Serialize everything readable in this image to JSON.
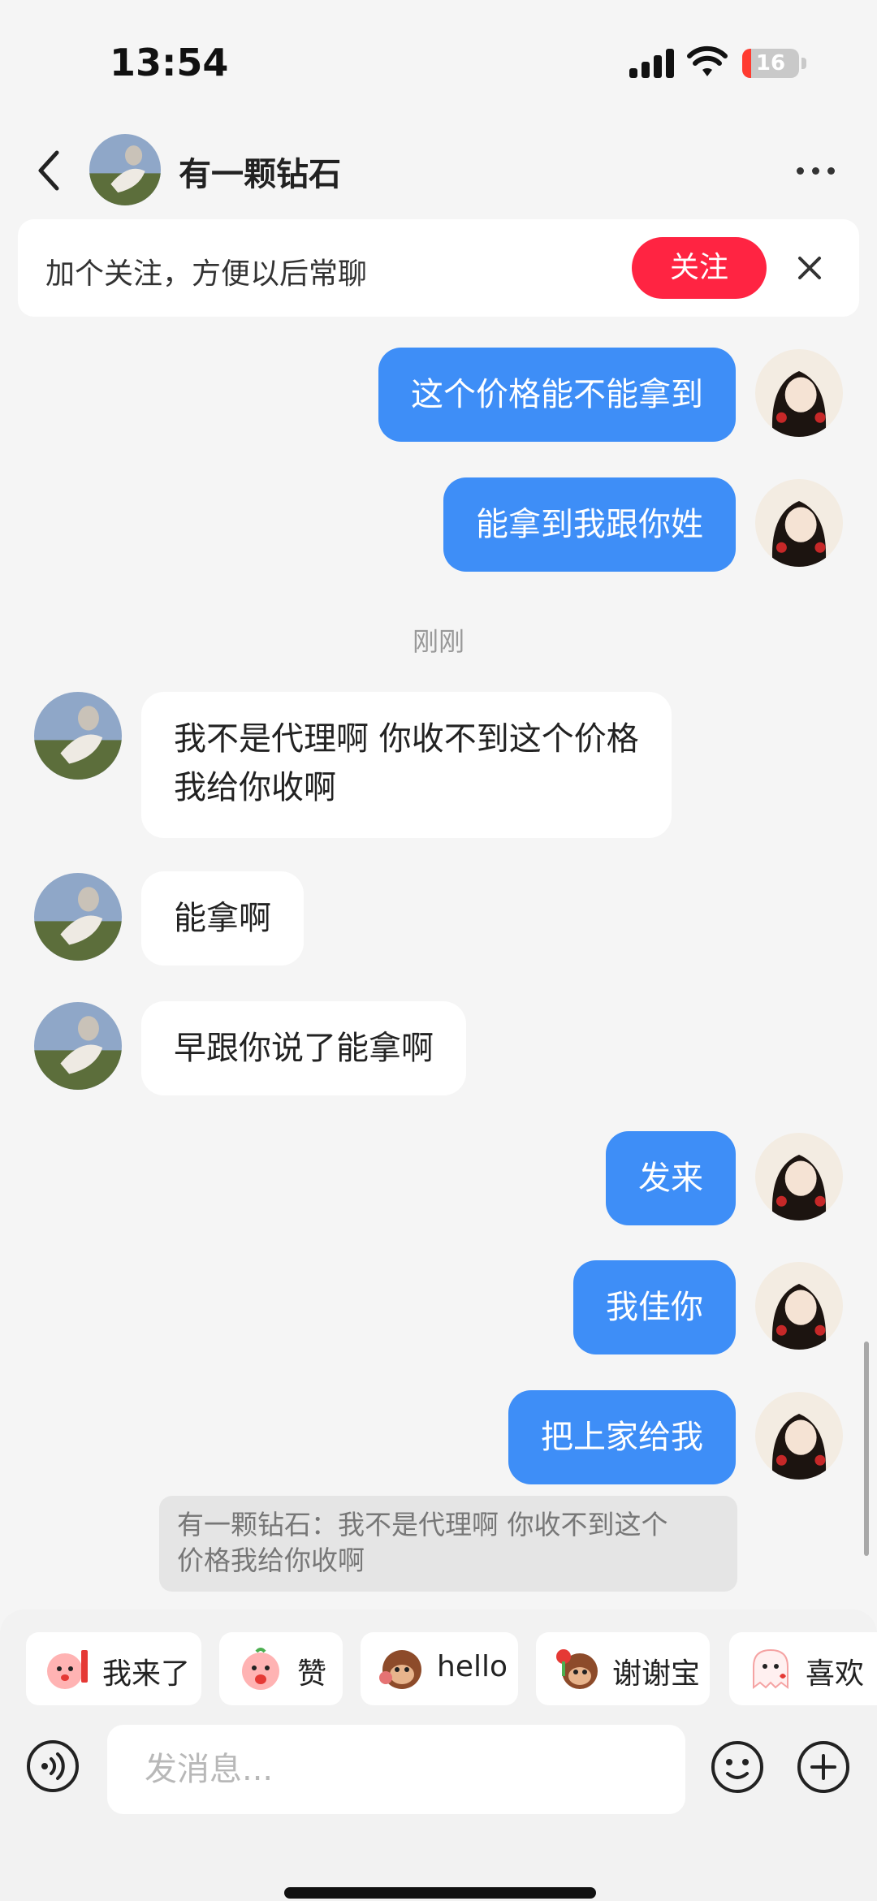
{
  "status_bar": {
    "time": "13:54",
    "battery": "16",
    "battery_level": 0.16
  },
  "header": {
    "contact_name": "有一颗钻石",
    "back_icon": "chevron-left-icon",
    "more_icon": "more-horizontal-icon"
  },
  "follow_banner": {
    "text": "加个关注，方便以后常聊",
    "follow_label": "关注",
    "close_icon": "close-icon"
  },
  "messages": [
    {
      "side": "mine",
      "text": "这个价格能不能拿到"
    },
    {
      "side": "mine",
      "text": "能拿到我跟你姓"
    },
    {
      "side": "theirs",
      "line1": "我不是代理啊 你收不到这个价格",
      "line2": "我给你收啊"
    },
    {
      "side": "theirs",
      "text": "能拿啊"
    },
    {
      "side": "theirs",
      "text": "早跟你说了能拿啊"
    },
    {
      "side": "mine",
      "text": "发来"
    },
    {
      "side": "mine",
      "text": "我佳你"
    },
    {
      "side": "mine",
      "text": "把上家给我"
    }
  ],
  "time_separator": "刚刚",
  "quote": {
    "line1": "有一颗钻石：我不是代理啊 你收不到这个",
    "line2": "价格我给你收啊"
  },
  "quick_replies": [
    {
      "label": "我来了",
      "icon": "sticker-peach-sign-icon"
    },
    {
      "label": "赞",
      "icon": "sticker-peach-wow-icon"
    },
    {
      "label": "hello",
      "icon": "sticker-monkey-wave-icon"
    },
    {
      "label": "谢谢宝",
      "icon": "sticker-monkey-flower-icon"
    },
    {
      "label": "喜欢",
      "icon": "sticker-ghost-love-icon"
    }
  ],
  "input": {
    "placeholder": "发消息..."
  },
  "colors": {
    "accent_blue": "#3e8ef7",
    "follow_red": "#ff2442",
    "background": "#f5f5f5"
  }
}
